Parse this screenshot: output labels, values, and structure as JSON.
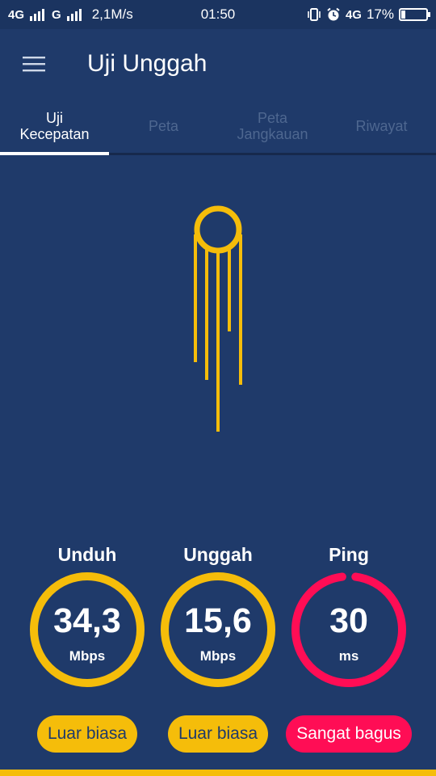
{
  "statusbar": {
    "network1": "4G",
    "network2": "G",
    "speed": "2,1M/s",
    "time": "01:50",
    "net_right": "4G",
    "battery_pct": "17%",
    "battery_level": 0.17
  },
  "appbar": {
    "title": "Uji Unggah",
    "menu_icon": "hamburger-menu-icon"
  },
  "tabs": [
    {
      "label": "Uji\nKecepatan",
      "active": true
    },
    {
      "label": "Peta",
      "active": false
    },
    {
      "label": "Peta\nJangkauan",
      "active": false
    },
    {
      "label": "Riwayat",
      "active": false
    }
  ],
  "metrics": [
    {
      "label": "Unduh",
      "value": "34,3",
      "unit": "Mbps",
      "rating": "Luar biasa",
      "color": "#f5bd0a",
      "progress": 1.0
    },
    {
      "label": "Unggah",
      "value": "15,6",
      "unit": "Mbps",
      "rating": "Luar biasa",
      "color": "#f5bd0a",
      "progress": 1.0
    },
    {
      "label": "Ping",
      "value": "30",
      "unit": "ms",
      "rating": "Sangat bagus",
      "color": "#ff0d55",
      "progress": 0.96
    }
  ],
  "colors": {
    "background": "#1f3a6a",
    "accent": "#f5bd0a",
    "ping": "#ff0d55",
    "badge_text_yellow": "#1f3a6a"
  }
}
